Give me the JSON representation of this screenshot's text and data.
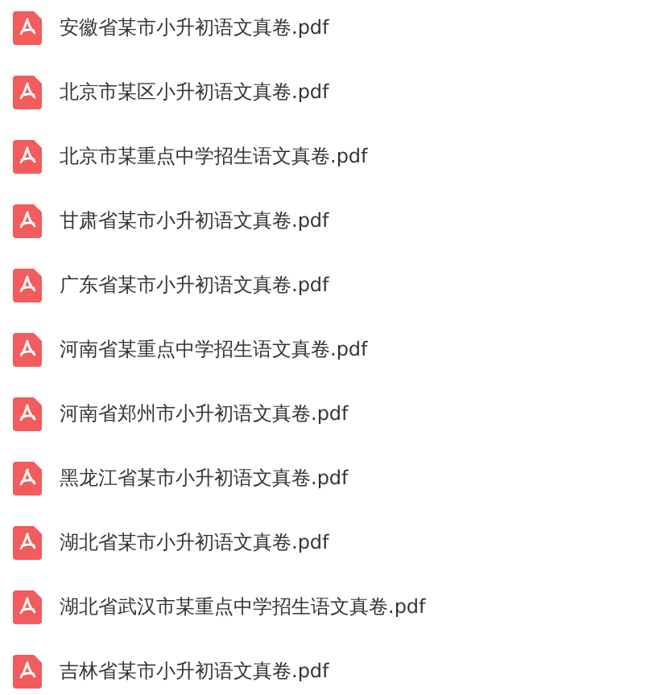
{
  "files": [
    {
      "name": "安徽省某市小升初语文真卷.pdf"
    },
    {
      "name": "北京市某区小升初语文真卷.pdf"
    },
    {
      "name": "北京市某重点中学招生语文真卷.pdf"
    },
    {
      "name": "甘肃省某市小升初语文真卷.pdf"
    },
    {
      "name": "广东省某市小升初语文真卷.pdf"
    },
    {
      "name": "河南省某重点中学招生语文真卷.pdf"
    },
    {
      "name": "河南省郑州市小升初语文真卷.pdf"
    },
    {
      "name": "黑龙江省某市小升初语文真卷.pdf"
    },
    {
      "name": "湖北省某市小升初语文真卷.pdf"
    },
    {
      "name": "湖北省武汉市某重点中学招生语文真卷.pdf"
    },
    {
      "name": "吉林省某市小升初语文真卷.pdf"
    }
  ]
}
